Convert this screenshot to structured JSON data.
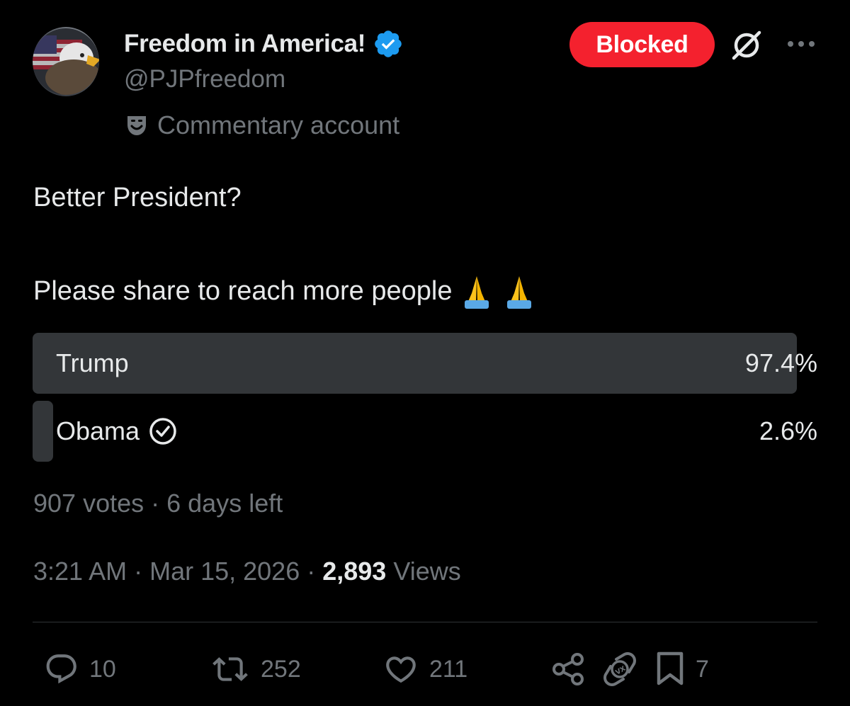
{
  "author": {
    "display_name": "Freedom in America!",
    "handle": "@PJPfreedom",
    "affiliation_label": "Commentary account",
    "verified": true
  },
  "header_actions": {
    "blocked_label": "Blocked"
  },
  "tweet": {
    "line1": "Better President?",
    "line2": "Please share to reach more people",
    "emojis": "🙏🙏"
  },
  "poll": {
    "options": [
      {
        "label": "Trump",
        "percent_label": "97.4%",
        "fraction": 0.974,
        "selected": false
      },
      {
        "label": "Obama",
        "percent_label": "2.6%",
        "fraction": 0.026,
        "selected": true
      }
    ],
    "votes": "907 votes",
    "separator": " · ",
    "time_left": "6 days left"
  },
  "meta": {
    "time": "3:21 AM",
    "date": "Mar 15, 2026",
    "views_count": "2,893",
    "views_label": "Views",
    "separator": " · "
  },
  "actions": {
    "replies": "10",
    "reposts": "252",
    "likes": "211",
    "bookmarks": "7"
  },
  "colors": {
    "background": "#000000",
    "text_primary": "#e7e9ea",
    "text_secondary": "#71767b",
    "verified_blue": "#1d9bf0",
    "blocked_red": "#f4212e",
    "poll_bar": "#333639",
    "divider": "#2f3336"
  }
}
